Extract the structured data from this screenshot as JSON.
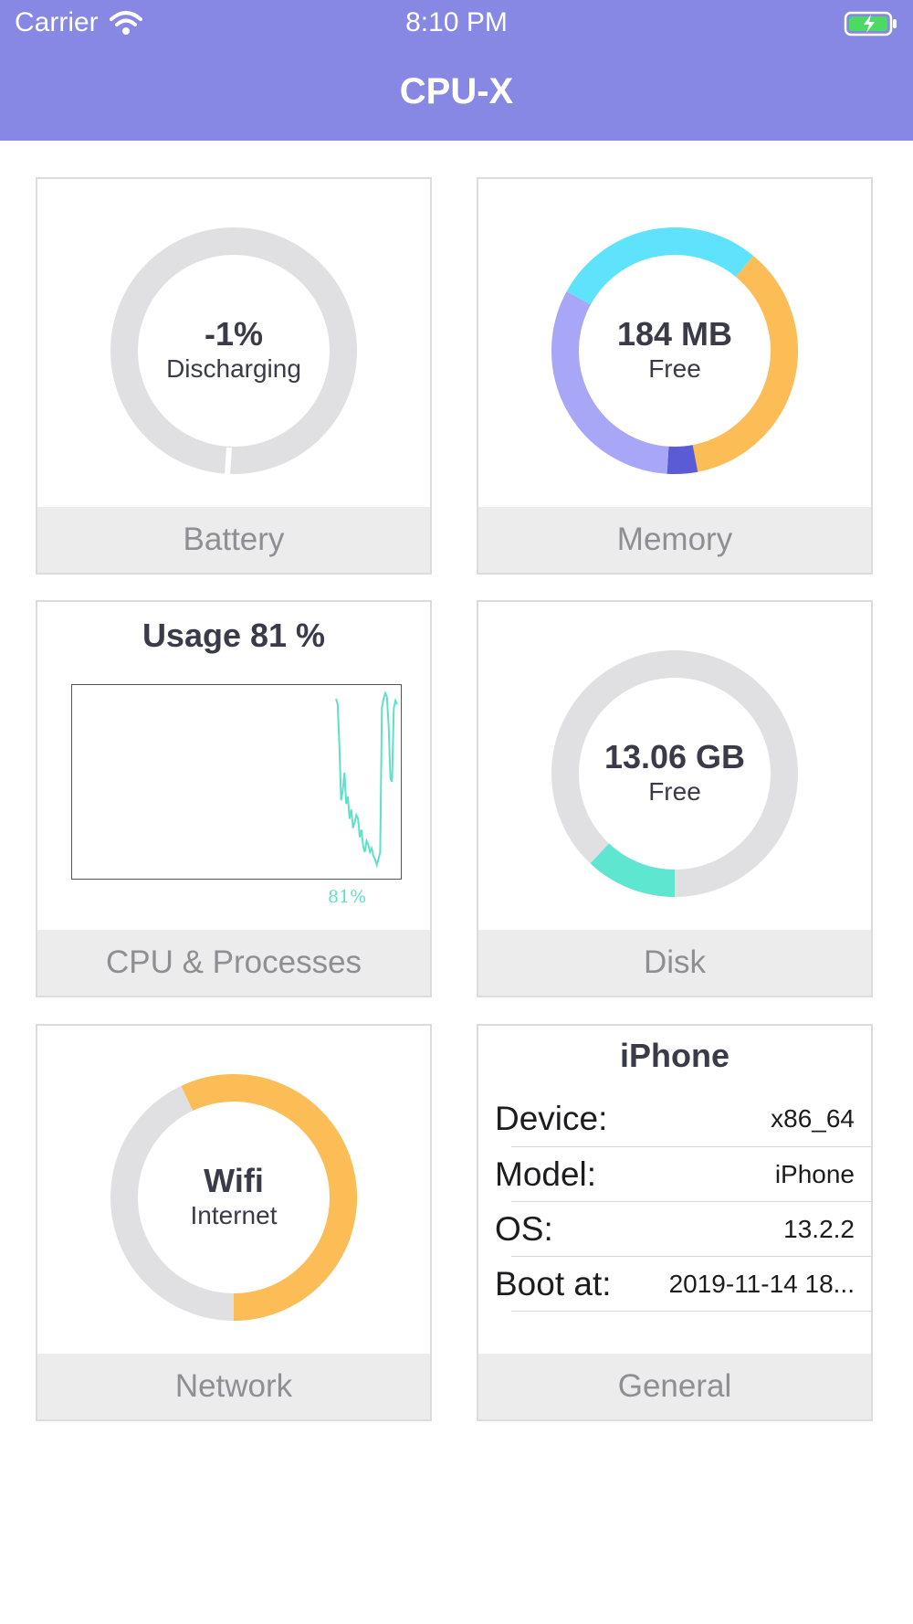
{
  "status_bar": {
    "carrier": "Carrier",
    "time": "8:10 PM"
  },
  "app": {
    "title": "CPU-X",
    "header_color": "#8787e4"
  },
  "cards": {
    "battery": {
      "value": "-1%",
      "status": "Discharging",
      "label": "Battery",
      "level": 0.01,
      "ring_color": "#e0e0e3"
    },
    "memory": {
      "value": "184 MB",
      "status": "Free",
      "label": "Memory",
      "segments": [
        {
          "fraction": 0.36,
          "color": "#fcbd57"
        },
        {
          "fraction": 0.04,
          "color": "#5b5bd6"
        },
        {
          "fraction": 0.32,
          "color": "#a8a6f7"
        },
        {
          "fraction": 0.28,
          "color": "#5fe3fc"
        }
      ]
    },
    "cpu": {
      "title": "Usage 81 %",
      "percent_label": "81%",
      "label": "CPU & Processes",
      "line_color": "#5fe0c8",
      "usage_history": [
        95,
        92,
        70,
        40,
        45,
        55,
        38,
        42,
        30,
        35,
        25,
        28,
        32,
        30,
        20,
        24,
        15,
        12,
        18,
        16,
        12,
        14,
        10,
        8,
        5,
        8,
        12,
        90,
        95,
        98,
        96,
        80,
        52,
        50,
        90,
        94,
        92
      ]
    },
    "disk": {
      "value": "13.06 GB",
      "status": "Free",
      "label": "Disk",
      "used_fraction": 0.12,
      "used_color": "#5fe6d0"
    },
    "network": {
      "value": "Wifi",
      "status": "Internet",
      "label": "Network",
      "fraction": 0.57,
      "color": "#fcbd57"
    },
    "general": {
      "title": "iPhone",
      "label": "General",
      "rows": [
        {
          "key": "Device:",
          "value": "x86_64"
        },
        {
          "key": "Model:",
          "value": "iPhone"
        },
        {
          "key": "OS:",
          "value": "13.2.2"
        },
        {
          "key": "Boot at:",
          "value": "2019-11-14 18..."
        }
      ]
    }
  }
}
